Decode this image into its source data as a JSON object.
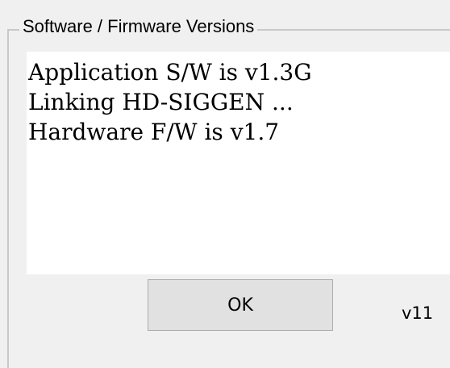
{
  "groupbox": {
    "title": "Software / Firmware Versions"
  },
  "log": {
    "lines": [
      "Application S/W is v1.3G",
      "Linking HD-SIGGEN ...",
      "Hardware F/W is v1.7"
    ]
  },
  "ok_button": {
    "label": "OK"
  },
  "version_label": "v11"
}
